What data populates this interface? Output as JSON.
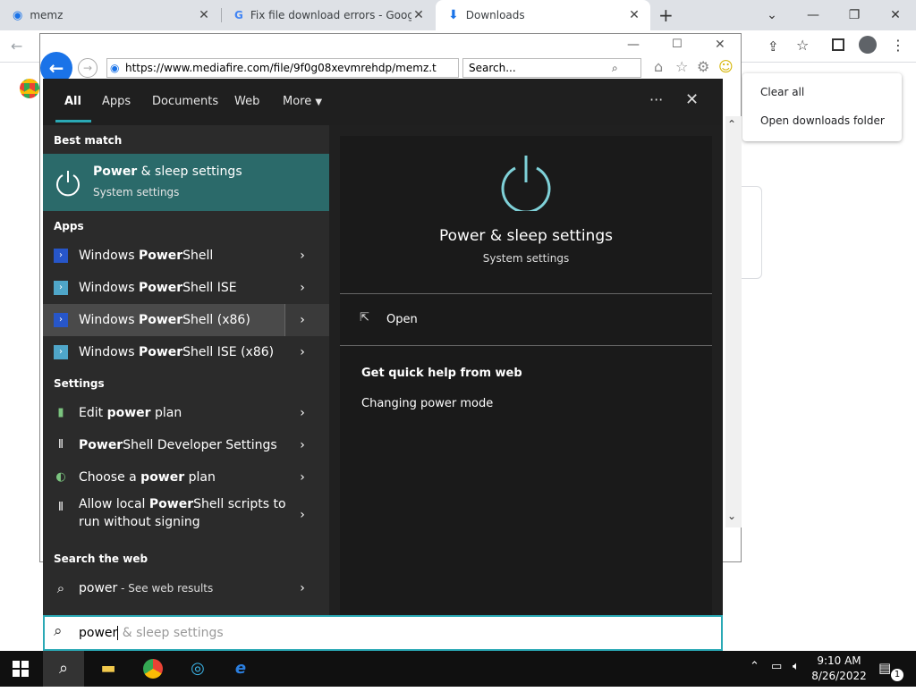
{
  "chrome": {
    "tabs": [
      {
        "title": "memz",
        "active": false
      },
      {
        "title": "Fix file download errors - Google",
        "active": false
      },
      {
        "title": "Downloads",
        "active": true
      }
    ],
    "new_tab": "+"
  },
  "downloads_menu": {
    "items": [
      "Clear all",
      "Open downloads folder"
    ]
  },
  "ie": {
    "url": "https://www.mediafire.com/file/9f0g08xevmrehdp/memz.t",
    "search_placeholder": "Search..."
  },
  "start": {
    "tabs": [
      "All",
      "Apps",
      "Documents",
      "Web",
      "More"
    ],
    "best_match_heading": "Best match",
    "best_match": {
      "title_pre": "Power",
      "title_post": " & sleep settings",
      "subtitle": "System settings"
    },
    "apps_heading": "Apps",
    "apps": [
      {
        "pre": "Windows ",
        "bold": "Power",
        "post": "Shell"
      },
      {
        "pre": "Windows ",
        "bold": "Power",
        "post": "Shell ISE"
      },
      {
        "pre": "Windows ",
        "bold": "Power",
        "post": "Shell (x86)"
      },
      {
        "pre": "Windows ",
        "bold": "Power",
        "post": "Shell ISE (x86)"
      }
    ],
    "settings_heading": "Settings",
    "settings": [
      {
        "pre": "Edit ",
        "bold": "power",
        "post": " plan"
      },
      {
        "pre": "",
        "bold": "Power",
        "post": "Shell Developer Settings"
      },
      {
        "pre": "Choose a ",
        "bold": "power",
        "post": " plan"
      },
      {
        "pre": "Allow local ",
        "bold": "Power",
        "post": "Shell scripts to",
        "line2": "run without signing"
      }
    ],
    "web_heading": "Search the web",
    "web_item": {
      "query": "power",
      "suffix": " - See web results"
    },
    "preview": {
      "title": "Power & sleep settings",
      "subtitle": "System settings",
      "open_label": "Open",
      "quick_help_heading": "Get quick help from web",
      "quick_help_link": "Changing power mode"
    },
    "search_typed": "power",
    "search_ghost": " & sleep settings"
  },
  "taskbar": {
    "time": "9:10 AM",
    "date": "8/26/2022",
    "notification_count": "1"
  },
  "colors": {
    "accent": "#2aa9b5",
    "best_match_bg": "#2b6a6a",
    "power_icon": "#7fd1d8"
  }
}
